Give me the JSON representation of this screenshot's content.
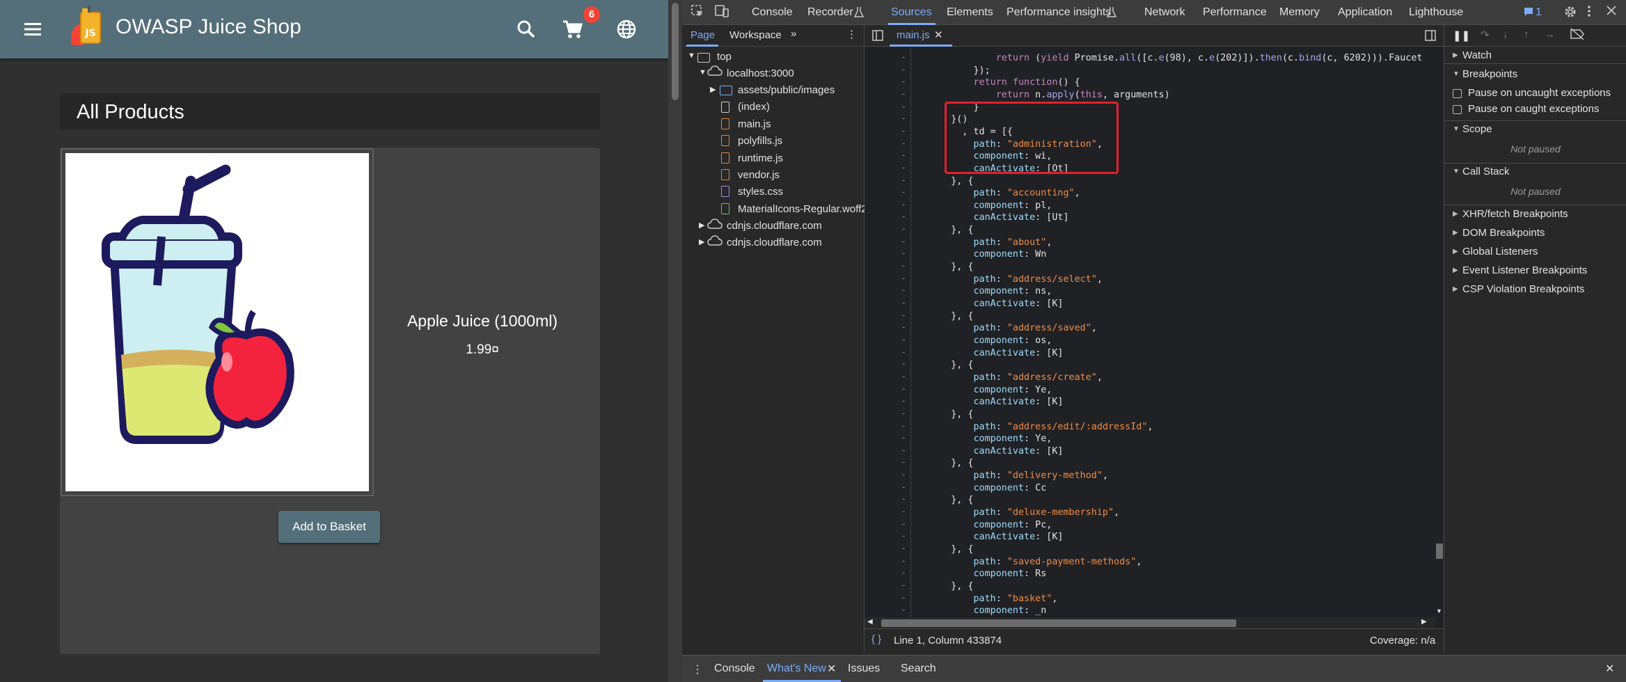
{
  "app": {
    "title": "OWASP Juice Shop",
    "cart_count": "6",
    "section_heading": "All Products",
    "product": {
      "name": "Apple Juice (1000ml)",
      "price": "1.99¤",
      "button": "Add to Basket"
    }
  },
  "devtools": {
    "tabs": [
      "Console",
      "Recorder",
      "Sources",
      "Elements",
      "Performance insights",
      "Network",
      "Performance",
      "Memory",
      "Application",
      "Lighthouse"
    ],
    "issues_count": "1",
    "nav_tabs": [
      "Page",
      "Workspace"
    ],
    "tree": [
      "top",
      "localhost:3000",
      "assets/public/images",
      "(index)",
      "main.js",
      "polyfills.js",
      "runtime.js",
      "vendor.js",
      "styles.css",
      "MaterialIcons-Regular.woff2",
      "cdnjs.cloudflare.com",
      "cdnjs.cloudflare.com"
    ],
    "open_file": "main.js",
    "code_lines": [
      [
        [
          "            ",
          "t"
        ],
        [
          "return",
          "k"
        ],
        [
          " (",
          "t"
        ],
        [
          "yield",
          "k"
        ],
        [
          " Promise.",
          "t"
        ],
        [
          "all",
          "n"
        ],
        [
          "([c.",
          "t"
        ],
        [
          "e",
          "n"
        ],
        [
          "(98), c.",
          "t"
        ],
        [
          "e",
          "n"
        ],
        [
          "(202)]).",
          "t"
        ],
        [
          "then",
          "n"
        ],
        [
          "(c.",
          "t"
        ],
        [
          "bind",
          "n"
        ],
        [
          "(c, 6202))).Faucet",
          "t"
        ]
      ],
      [
        [
          "        });",
          "t"
        ]
      ],
      [
        [
          "        ",
          "t"
        ],
        [
          "return",
          "k"
        ],
        [
          " ",
          "t"
        ],
        [
          "function",
          "k"
        ],
        [
          "() {",
          "t"
        ]
      ],
      [
        [
          "            ",
          "t"
        ],
        [
          "return",
          "k"
        ],
        [
          " n.",
          "t"
        ],
        [
          "apply",
          "n"
        ],
        [
          "(",
          "t"
        ],
        [
          "this",
          "k"
        ],
        [
          ", arguments)",
          "t"
        ]
      ],
      [
        [
          "        }",
          "t"
        ]
      ],
      [
        [
          "    }()",
          "t"
        ]
      ],
      [
        [
          "      , td = [{",
          "t"
        ]
      ],
      [
        [
          "        ",
          "t"
        ],
        [
          "path",
          "p"
        ],
        [
          ": ",
          "t"
        ],
        [
          "\"administration\"",
          "s"
        ],
        [
          ",",
          "t"
        ]
      ],
      [
        [
          "        ",
          "t"
        ],
        [
          "component",
          "p"
        ],
        [
          ": wi,",
          "t"
        ]
      ],
      [
        [
          "        ",
          "t"
        ],
        [
          "canActivate",
          "p"
        ],
        [
          ": [Ot]",
          "t"
        ]
      ],
      [
        [
          "    }, {",
          "t"
        ]
      ],
      [
        [
          "        ",
          "t"
        ],
        [
          "path",
          "p"
        ],
        [
          ": ",
          "t"
        ],
        [
          "\"accounting\"",
          "s"
        ],
        [
          ",",
          "t"
        ]
      ],
      [
        [
          "        ",
          "t"
        ],
        [
          "component",
          "p"
        ],
        [
          ": pl,",
          "t"
        ]
      ],
      [
        [
          "        ",
          "t"
        ],
        [
          "canActivate",
          "p"
        ],
        [
          ": [Ut]",
          "t"
        ]
      ],
      [
        [
          "    }, {",
          "t"
        ]
      ],
      [
        [
          "        ",
          "t"
        ],
        [
          "path",
          "p"
        ],
        [
          ": ",
          "t"
        ],
        [
          "\"about\"",
          "s"
        ],
        [
          ",",
          "t"
        ]
      ],
      [
        [
          "        ",
          "t"
        ],
        [
          "component",
          "p"
        ],
        [
          ": Wn",
          "t"
        ]
      ],
      [
        [
          "    }, {",
          "t"
        ]
      ],
      [
        [
          "        ",
          "t"
        ],
        [
          "path",
          "p"
        ],
        [
          ": ",
          "t"
        ],
        [
          "\"address/select\"",
          "s"
        ],
        [
          ",",
          "t"
        ]
      ],
      [
        [
          "        ",
          "t"
        ],
        [
          "component",
          "p"
        ],
        [
          ": ns,",
          "t"
        ]
      ],
      [
        [
          "        ",
          "t"
        ],
        [
          "canActivate",
          "p"
        ],
        [
          ": [K]",
          "t"
        ]
      ],
      [
        [
          "    }, {",
          "t"
        ]
      ],
      [
        [
          "        ",
          "t"
        ],
        [
          "path",
          "p"
        ],
        [
          ": ",
          "t"
        ],
        [
          "\"address/saved\"",
          "s"
        ],
        [
          ",",
          "t"
        ]
      ],
      [
        [
          "        ",
          "t"
        ],
        [
          "component",
          "p"
        ],
        [
          ": os,",
          "t"
        ]
      ],
      [
        [
          "        ",
          "t"
        ],
        [
          "canActivate",
          "p"
        ],
        [
          ": [K]",
          "t"
        ]
      ],
      [
        [
          "    }, {",
          "t"
        ]
      ],
      [
        [
          "        ",
          "t"
        ],
        [
          "path",
          "p"
        ],
        [
          ": ",
          "t"
        ],
        [
          "\"address/create\"",
          "s"
        ],
        [
          ",",
          "t"
        ]
      ],
      [
        [
          "        ",
          "t"
        ],
        [
          "component",
          "p"
        ],
        [
          ": Ye,",
          "t"
        ]
      ],
      [
        [
          "        ",
          "t"
        ],
        [
          "canActivate",
          "p"
        ],
        [
          ": [K]",
          "t"
        ]
      ],
      [
        [
          "    }, {",
          "t"
        ]
      ],
      [
        [
          "        ",
          "t"
        ],
        [
          "path",
          "p"
        ],
        [
          ": ",
          "t"
        ],
        [
          "\"address/edit/:addressId\"",
          "s"
        ],
        [
          ",",
          "t"
        ]
      ],
      [
        [
          "        ",
          "t"
        ],
        [
          "component",
          "p"
        ],
        [
          ": Ye,",
          "t"
        ]
      ],
      [
        [
          "        ",
          "t"
        ],
        [
          "canActivate",
          "p"
        ],
        [
          ": [K]",
          "t"
        ]
      ],
      [
        [
          "    }, {",
          "t"
        ]
      ],
      [
        [
          "        ",
          "t"
        ],
        [
          "path",
          "p"
        ],
        [
          ": ",
          "t"
        ],
        [
          "\"delivery-method\"",
          "s"
        ],
        [
          ",",
          "t"
        ]
      ],
      [
        [
          "        ",
          "t"
        ],
        [
          "component",
          "p"
        ],
        [
          ": Cc",
          "t"
        ]
      ],
      [
        [
          "    }, {",
          "t"
        ]
      ],
      [
        [
          "        ",
          "t"
        ],
        [
          "path",
          "p"
        ],
        [
          ": ",
          "t"
        ],
        [
          "\"deluxe-membership\"",
          "s"
        ],
        [
          ",",
          "t"
        ]
      ],
      [
        [
          "        ",
          "t"
        ],
        [
          "component",
          "p"
        ],
        [
          ": Pc,",
          "t"
        ]
      ],
      [
        [
          "        ",
          "t"
        ],
        [
          "canActivate",
          "p"
        ],
        [
          ": [K]",
          "t"
        ]
      ],
      [
        [
          "    }, {",
          "t"
        ]
      ],
      [
        [
          "        ",
          "t"
        ],
        [
          "path",
          "p"
        ],
        [
          ": ",
          "t"
        ],
        [
          "\"saved-payment-methods\"",
          "s"
        ],
        [
          ",",
          "t"
        ]
      ],
      [
        [
          "        ",
          "t"
        ],
        [
          "component",
          "p"
        ],
        [
          ": Rs",
          "t"
        ]
      ],
      [
        [
          "    }, {",
          "t"
        ]
      ],
      [
        [
          "        ",
          "t"
        ],
        [
          "path",
          "p"
        ],
        [
          ": ",
          "t"
        ],
        [
          "\"basket\"",
          "s"
        ],
        [
          ",",
          "t"
        ]
      ],
      [
        [
          "        ",
          "t"
        ],
        [
          "component",
          "p"
        ],
        [
          ": _n",
          "t"
        ]
      ],
      [
        [
          "    }, {",
          "t"
        ]
      ]
    ],
    "line_marker": "-",
    "status_position": "Line 1, Column 433874",
    "coverage": "Coverage: n/a",
    "right_panel": {
      "watch": "Watch",
      "breakpoints": "Breakpoints",
      "pause_uncaught": "Pause on uncaught exceptions",
      "pause_caught": "Pause on caught exceptions",
      "scope": "Scope",
      "not_paused": "Not paused",
      "call_stack": "Call Stack",
      "xhr": "XHR/fetch Breakpoints",
      "dom": "DOM Breakpoints",
      "global": "Global Listeners",
      "event": "Event Listener Breakpoints",
      "csp": "CSP Violation Breakpoints"
    },
    "drawer_tabs": [
      "Console",
      "What's New",
      "Issues",
      "Search"
    ]
  }
}
